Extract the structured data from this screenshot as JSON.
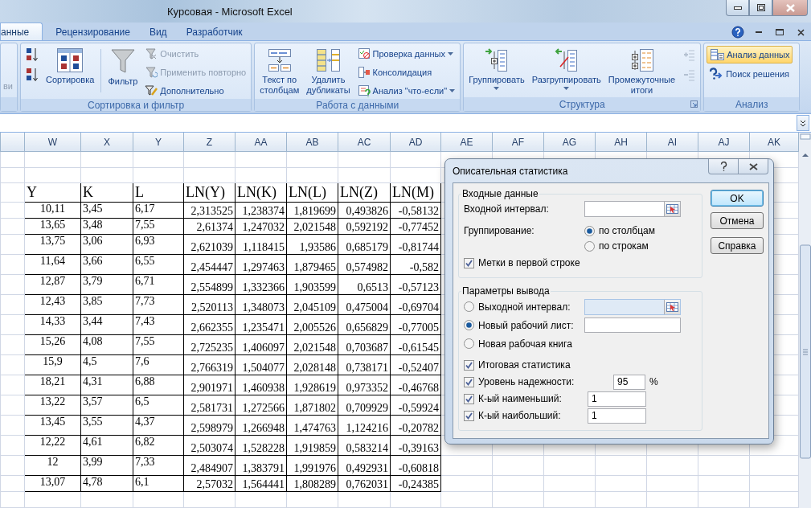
{
  "window": {
    "title": "Курсовая - Microsoft Excel"
  },
  "tabs": [
    {
      "label": "анные",
      "selected": true
    },
    {
      "label": "Рецензирование",
      "selected": false
    },
    {
      "label": "Вид",
      "selected": false
    },
    {
      "label": "Разработчик",
      "selected": false
    }
  ],
  "ribbon": {
    "groups": [
      {
        "items": [
          {
            "kind": "small",
            "lines": [
              "ви"
            ],
            "disabled": true
          }
        ]
      },
      {
        "title": "Сортировка и фильтр",
        "items": [
          {
            "kind": "icon"
          },
          {
            "kind": "icon"
          },
          {
            "kind": "large",
            "lines": [
              "Сортировка"
            ]
          },
          {
            "kind": "separator"
          },
          {
            "kind": "large",
            "lines": [
              "Фильтр"
            ]
          },
          {
            "kind": "small",
            "lines": [
              "Очистить"
            ],
            "disabled": true
          },
          {
            "kind": "small",
            "lines": [
              "Применить повторно"
            ],
            "disabled": true
          },
          {
            "kind": "small",
            "lines": [
              "Дополнительно"
            ],
            "disabled": false
          }
        ]
      },
      {
        "title": "Работа с данными",
        "items": [
          {
            "kind": "large",
            "lines": [
              "Текст по",
              "столбцам"
            ]
          },
          {
            "kind": "large",
            "lines": [
              "Удалить",
              "дубликаты"
            ]
          },
          {
            "kind": "small",
            "lines": [
              "Проверка данных"
            ],
            "has_menu": true
          },
          {
            "kind": "small",
            "lines": [
              "Консолидация"
            ],
            "has_menu": false
          },
          {
            "kind": "small",
            "lines": [
              "Анализ \"что-если\""
            ],
            "has_menu": true
          }
        ]
      },
      {
        "title": "Структура",
        "launcher": true,
        "items": [
          {
            "kind": "large",
            "lines": [
              "Группировать"
            ],
            "has_menu": true
          },
          {
            "kind": "large",
            "lines": [
              "Разгруппировать"
            ],
            "has_menu": true
          },
          {
            "kind": "large",
            "lines": [
              "Промежуточные",
              "итоги"
            ],
            "has_menu": false
          },
          {
            "kind": "icon",
            "disabled": true
          },
          {
            "kind": "icon",
            "disabled": true
          }
        ]
      },
      {
        "title": "Анализ",
        "items": [
          {
            "kind": "small",
            "lines": [
              "Анализ данных"
            ],
            "highlighted": true
          },
          {
            "kind": "small",
            "lines": [
              "Поиск решения"
            ],
            "highlighted": false
          }
        ]
      }
    ]
  },
  "columns": [
    "W",
    "X",
    "Y",
    "Z",
    "AA",
    "AB",
    "AC",
    "AD",
    "AE",
    "AF",
    "AG",
    "AH",
    "AI",
    "AJ",
    "AK"
  ],
  "table": {
    "header": [
      "Y",
      "K",
      "L",
      "LN(Y)",
      "LN(K)",
      "LN(L)",
      "LN(Z)",
      "LN(M)"
    ],
    "rows": [
      [
        "10,11",
        "3,45",
        "6,17",
        "2,313525",
        "1,238374",
        "1,819699",
        "0,493826",
        "-0,58132"
      ],
      [
        "13,65",
        "3,48",
        "7,55",
        "2,61374",
        "1,247032",
        "2,021548",
        "0,592192",
        "-0,77452"
      ],
      [
        "13,75",
        "3,06",
        "6,93",
        "2,621039",
        "1,118415",
        "1,93586",
        "0,685179",
        "-0,81744"
      ],
      [
        "11,64",
        "3,66",
        "6,55",
        "2,454447",
        "1,297463",
        "1,879465",
        "0,574982",
        "-0,582"
      ],
      [
        "12,87",
        "3,79",
        "6,71",
        "2,554899",
        "1,332366",
        "1,903599",
        "0,6513",
        "-0,57123"
      ],
      [
        "12,43",
        "3,85",
        "7,73",
        "2,520113",
        "1,348073",
        "2,045109",
        "0,475004",
        "-0,69704"
      ],
      [
        "14,33",
        "3,44",
        "7,43",
        "2,662355",
        "1,235471",
        "2,005526",
        "0,656829",
        "-0,77005"
      ],
      [
        "15,26",
        "4,08",
        "7,55",
        "2,725235",
        "1,406097",
        "2,021548",
        "0,703687",
        "-0,61545"
      ],
      [
        "15,9",
        "4,5",
        "7,6",
        "2,766319",
        "1,504077",
        "2,028148",
        "0,738171",
        "-0,52407"
      ],
      [
        "18,21",
        "4,31",
        "6,88",
        "2,901971",
        "1,460938",
        "1,928619",
        "0,973352",
        "-0,46768"
      ],
      [
        "13,22",
        "3,57",
        "6,5",
        "2,581731",
        "1,272566",
        "1,871802",
        "0,709929",
        "-0,59924"
      ],
      [
        "13,45",
        "3,55",
        "4,37",
        "2,598979",
        "1,266948",
        "1,474763",
        "1,124216",
        "-0,20782"
      ],
      [
        "12,22",
        "4,61",
        "6,82",
        "2,503074",
        "1,528228",
        "1,919859",
        "0,583214",
        "-0,39163"
      ],
      [
        "12",
        "3,99",
        "7,33",
        "2,484907",
        "1,383791",
        "1,991976",
        "0,492931",
        "-0,60818"
      ],
      [
        "13,07",
        "4,78",
        "6,1",
        "2,57032",
        "1,564441",
        "1,808289",
        "0,762031",
        "-0,24385"
      ]
    ]
  },
  "dialog": {
    "title": "Описательная статистика",
    "input": {
      "title": "Входные данные",
      "range_label": "Входной интервал:",
      "grouping_label": "Группирование:",
      "grouping": [
        {
          "label": "по столбцам",
          "selected": true
        },
        {
          "label": "по строкам",
          "selected": false
        }
      ],
      "labels_in_first_row": {
        "label": "Метки в первой строке",
        "checked": true
      }
    },
    "output": {
      "title": "Параметры вывода",
      "destinations": [
        {
          "kind": "range",
          "label": "Выходной интервал:",
          "selected": false
        },
        {
          "kind": "field",
          "label": "Новый рабочий лист:",
          "selected": true
        },
        {
          "kind": "none",
          "label": "Новая рабочая книга",
          "selected": false
        }
      ],
      "options": [
        {
          "kind": "plain",
          "label": "Итоговая статистика",
          "checked": true
        },
        {
          "kind": "percent",
          "label": "Уровень надежности:",
          "checked": true,
          "value": "95",
          "unit": "%"
        },
        {
          "kind": "number",
          "label": "К-ый наименьший:",
          "checked": true,
          "value": "1"
        },
        {
          "kind": "number",
          "label": "К-ый наибольший:",
          "checked": true,
          "value": "1"
        }
      ]
    },
    "buttons": [
      {
        "label": "OK",
        "default": true
      },
      {
        "label": "Отмена",
        "default": false
      },
      {
        "label": "Справка",
        "default": false
      }
    ]
  }
}
